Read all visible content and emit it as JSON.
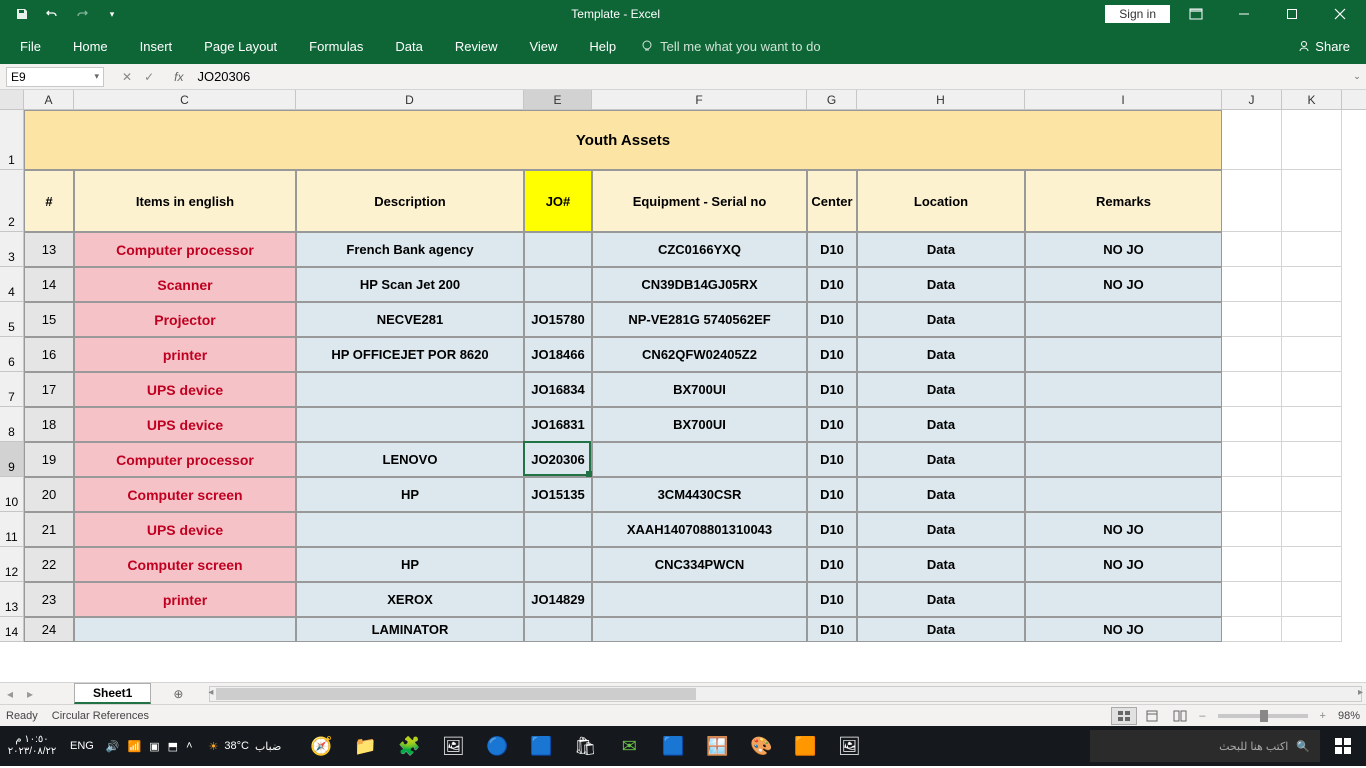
{
  "app": {
    "title": "Template  -  Excel"
  },
  "titlebar": {
    "signin": "Sign in"
  },
  "ribbon": {
    "file": "File",
    "tabs": [
      "Home",
      "Insert",
      "Page Layout",
      "Formulas",
      "Data",
      "Review",
      "View",
      "Help"
    ],
    "tellme": "Tell me what you want to do",
    "share": "Share"
  },
  "formulabar": {
    "name": "E9",
    "value": "JO20306"
  },
  "columns": [
    "A",
    "C",
    "D",
    "E",
    "F",
    "G",
    "H",
    "I",
    "J",
    "K"
  ],
  "sheet": {
    "title": "Youth Assets",
    "headers": {
      "num": "#",
      "items": "Items in english",
      "desc": "Description",
      "jo": "JO#",
      "equip": "Equipment - Serial no",
      "center": "Center",
      "loc": "Location",
      "rem": "Remarks"
    },
    "rows": [
      {
        "rh": "3",
        "n": "13",
        "item": "Computer processor",
        "desc": "French Bank agency",
        "jo": "",
        "equip": "CZC0166YXQ",
        "center": "D10",
        "loc": "Data",
        "rem": "NO JO"
      },
      {
        "rh": "4",
        "n": "14",
        "item": "Scanner",
        "desc": "HP Scan Jet 200",
        "jo": "",
        "equip": "CN39DB14GJ05RX",
        "center": "D10",
        "loc": "Data",
        "rem": "NO JO"
      },
      {
        "rh": "5",
        "n": "15",
        "item": "Projector",
        "desc": "NECVE281",
        "jo": "JO15780",
        "equip": "NP-VE281G   5740562EF",
        "center": "D10",
        "loc": "Data",
        "rem": ""
      },
      {
        "rh": "6",
        "n": "16",
        "item": "printer",
        "desc": "HP OFFICEJET POR 8620",
        "jo": "JO18466",
        "equip": "CN62QFW02405Z2",
        "center": "D10",
        "loc": "Data",
        "rem": ""
      },
      {
        "rh": "7",
        "n": "17",
        "item": "UPS device",
        "desc": "",
        "jo": "JO16834",
        "equip": "BX700UI",
        "center": "D10",
        "loc": "Data",
        "rem": ""
      },
      {
        "rh": "8",
        "n": "18",
        "item": "UPS device",
        "desc": "",
        "jo": "JO16831",
        "equip": "BX700UI",
        "center": "D10",
        "loc": "Data",
        "rem": ""
      },
      {
        "rh": "9",
        "n": "19",
        "item": "Computer processor",
        "desc": "LENOVO",
        "jo": "JO20306",
        "equip": "",
        "center": "D10",
        "loc": "Data",
        "rem": ""
      },
      {
        "rh": "10",
        "n": "20",
        "item": "Computer screen",
        "desc": "HP",
        "jo": "JO15135",
        "equip": "3CM4430CSR",
        "center": "D10",
        "loc": "Data",
        "rem": ""
      },
      {
        "rh": "11",
        "n": "21",
        "item": "UPS device",
        "desc": "",
        "jo": "",
        "equip": "XAAH140708801310043",
        "center": "D10",
        "loc": "Data",
        "rem": "NO JO"
      },
      {
        "rh": "12",
        "n": "22",
        "item": "Computer screen",
        "desc": "HP",
        "jo": "",
        "equip": "CNC334PWCN",
        "center": "D10",
        "loc": "Data",
        "rem": "NO JO"
      },
      {
        "rh": "13",
        "n": "23",
        "item": "printer",
        "desc": "XEROX",
        "jo": "JO14829",
        "equip": "",
        "center": "D10",
        "loc": "Data",
        "rem": ""
      },
      {
        "rh": "14",
        "n": "24",
        "item": "",
        "desc": "LAMINATOR",
        "jo": "",
        "equip": "",
        "center": "D10",
        "loc": "Data",
        "rem": "NO JO"
      }
    ]
  },
  "tabs": {
    "active": "Sheet1"
  },
  "status": {
    "ready": "Ready",
    "circ": "Circular References",
    "zoom": "98%"
  },
  "taskbar": {
    "time": "١٠:٥٠ م",
    "date": "٢٠٢٣/٠٨/٢٢",
    "lang": "ENG",
    "weather_temp": "38°C",
    "weather_label": "ضباب",
    "search": "اكتب هنا للبحث"
  }
}
